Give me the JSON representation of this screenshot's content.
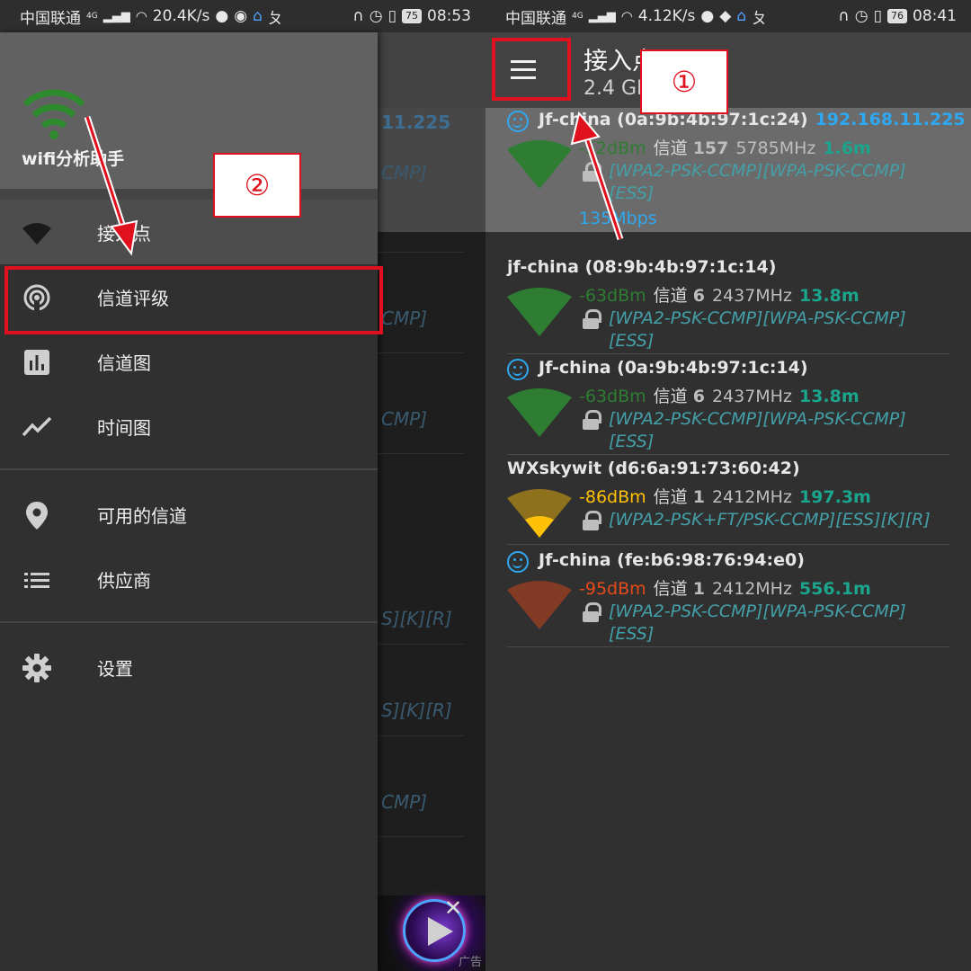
{
  "colors": {
    "accent_blue": "#2ea8f0",
    "green": "#2e7d32",
    "teal": "#1aa58c",
    "orange": "#ffc107",
    "red": "#e64a19",
    "annotation_red": "#e0101e"
  },
  "left": {
    "statusbar": {
      "carrier": "中国联通",
      "net": "4G",
      "speed": "20.4K/s",
      "battery": "75",
      "time": "08:53"
    },
    "drawer": {
      "app_name": "wifi分析助手",
      "items": [
        {
          "label": "接入点",
          "icon": "wifi-icon"
        },
        {
          "label": "信道评级",
          "icon": "signal-rating-icon"
        },
        {
          "label": "信道图",
          "icon": "bar-chart-icon"
        },
        {
          "label": "时间图",
          "icon": "line-chart-icon"
        },
        {
          "label": "可用的信道",
          "icon": "location-pin-icon"
        },
        {
          "label": "供应商",
          "icon": "list-icon"
        },
        {
          "label": "设置",
          "icon": "gear-icon"
        }
      ]
    },
    "underlying": {
      "fragments": [
        "11.225",
        "CMP]",
        "CMP]",
        "CMP]",
        "S][K][R]",
        "S][K][R]",
        "CMP]"
      ]
    },
    "ad": {
      "label": "广告"
    },
    "callout_label": "②"
  },
  "right": {
    "statusbar": {
      "carrier": "中国联通",
      "net": "4G",
      "speed": "4.12K/s",
      "battery": "76",
      "time": "08:41"
    },
    "toolbar": {
      "title": "接入点",
      "subtitle": "2.4 GHz",
      "menu_icon": "hamburger-menu-icon"
    },
    "access_points": [
      {
        "ssid": "Jf-china (0a:9b:4b:97:1c:24)",
        "ip": "192.168.11.225",
        "level": "-52dBm",
        "channel_label": "信道",
        "channel": "157",
        "freq": "5785MHz",
        "distance": "1.6m",
        "caps": [
          "[WPA2-PSK-CCMP][WPA-PSK-CCMP]",
          "[ESS]"
        ],
        "speed": "135Mbps",
        "smiley": true,
        "selected": true,
        "level_color": "#2e7d32"
      },
      {
        "ssid": "jf-china (08:9b:4b:97:1c:14)",
        "ip": "",
        "level": "-63dBm",
        "channel_label": "信道",
        "channel": "6",
        "freq": "2437MHz",
        "distance": "13.8m",
        "caps": [
          "[WPA2-PSK-CCMP][WPA-PSK-CCMP]",
          "[ESS]"
        ],
        "speed": "",
        "smiley": false,
        "selected": false,
        "level_color": "#2e7d32"
      },
      {
        "ssid": "Jf-china (0a:9b:4b:97:1c:14)",
        "ip": "",
        "level": "-63dBm",
        "channel_label": "信道",
        "channel": "6",
        "freq": "2437MHz",
        "distance": "13.8m",
        "caps": [
          "[WPA2-PSK-CCMP][WPA-PSK-CCMP]",
          "[ESS]"
        ],
        "speed": "",
        "smiley": true,
        "selected": false,
        "level_color": "#2e7d32"
      },
      {
        "ssid": "WXskywit (d6:6a:91:73:60:42)",
        "ip": "",
        "level": "-86dBm",
        "channel_label": "信道",
        "channel": "1",
        "freq": "2412MHz",
        "distance": "197.3m",
        "caps": [
          "[WPA2-PSK+FT/PSK-CCMP][ESS][K][R]"
        ],
        "speed": "",
        "smiley": false,
        "selected": false,
        "level_color": "#ffc107"
      },
      {
        "ssid": "Jf-china (fe:b6:98:76:94:e0)",
        "ip": "",
        "level": "-95dBm",
        "channel_label": "信道",
        "channel": "1",
        "freq": "2412MHz",
        "distance": "556.1m",
        "caps": [
          "[WPA2-PSK-CCMP][WPA-PSK-CCMP]",
          "[ESS]"
        ],
        "speed": "",
        "smiley": true,
        "selected": false,
        "level_color": "#e64a19"
      }
    ],
    "callout_label": "①"
  }
}
